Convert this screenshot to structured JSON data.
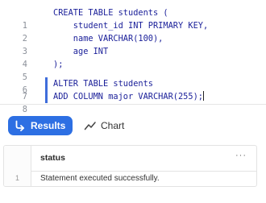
{
  "editor": {
    "lines": [
      {
        "num": "1",
        "text": "CREATE TABLE students (",
        "selected": false
      },
      {
        "num": "2",
        "text": "    student_id INT PRIMARY KEY,",
        "selected": false
      },
      {
        "num": "3",
        "text": "    name VARCHAR(100),",
        "selected": false
      },
      {
        "num": "4",
        "text": "    age INT",
        "selected": false
      },
      {
        "num": "5",
        "text": ");",
        "selected": false
      },
      {
        "num": "6",
        "text": "",
        "selected": false
      },
      {
        "num": "7",
        "text": "ALTER TABLE students",
        "selected": true
      },
      {
        "num": "8",
        "text": "ADD COLUMN major VARCHAR(255);",
        "selected": true
      }
    ],
    "code_color": "#1a1f99",
    "selection_bar_color": "#3f6ddb"
  },
  "tabs": {
    "results_label": "Results",
    "results_icon": "results-arrow-icon",
    "chart_label": "Chart",
    "chart_icon": "line-chart-icon",
    "active_color": "#2d6fe3"
  },
  "results": {
    "columns": [
      "status"
    ],
    "menu_icon": "more-horizontal-icon",
    "menu_glyph": "···",
    "rows": [
      {
        "num": "1",
        "values": [
          "Statement executed successfully."
        ]
      }
    ]
  }
}
